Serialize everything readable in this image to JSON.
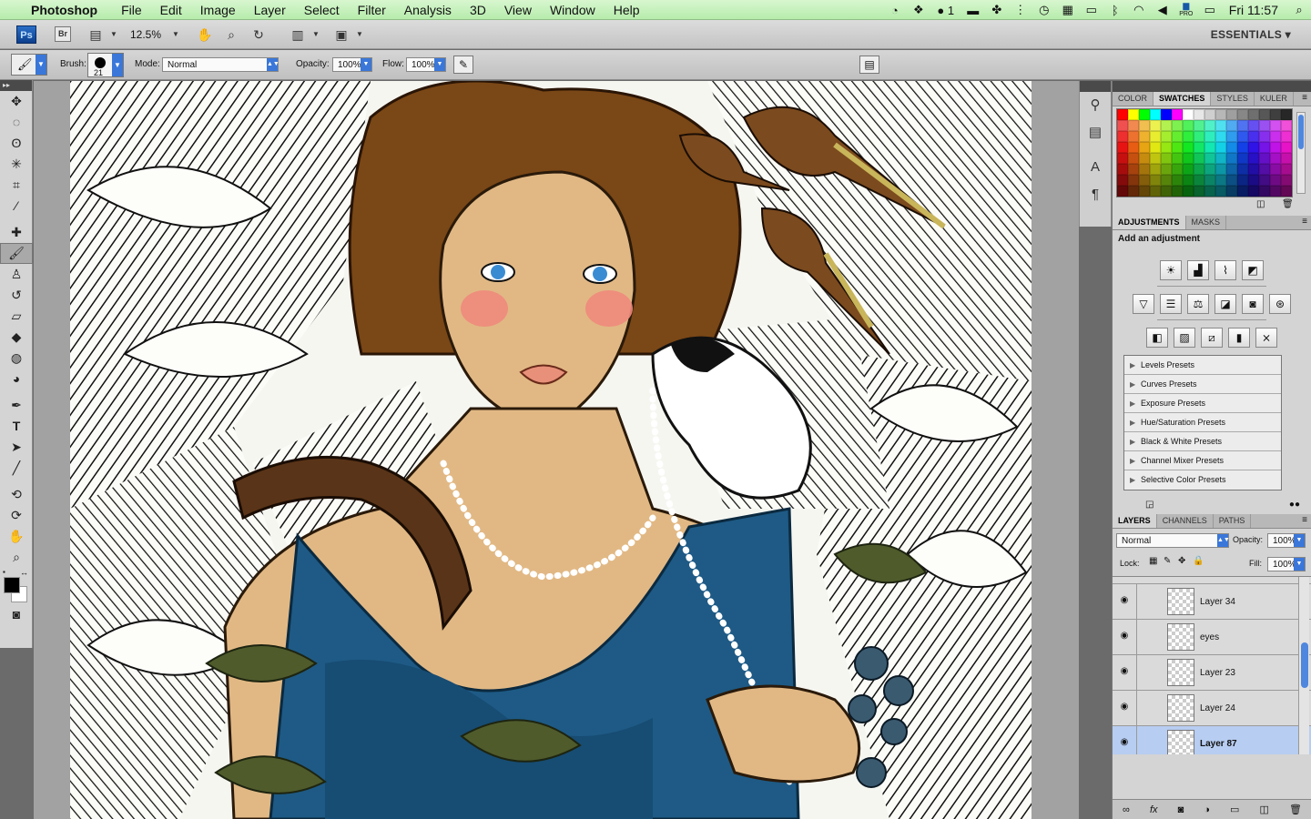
{
  "menubar": {
    "app_name": "Photoshop",
    "items": [
      "File",
      "Edit",
      "Image",
      "Layer",
      "Select",
      "Filter",
      "Analysis",
      "3D",
      "View",
      "Window",
      "Help"
    ],
    "badge_count": "1",
    "keyboard_label": "PRO",
    "clock": "Fri 11:57"
  },
  "appbar": {
    "ps_logo": "Ps",
    "bridge_logo": "Br",
    "zoom": "12.5%",
    "workspace": "ESSENTIALS ▾"
  },
  "options": {
    "brush_label": "Brush:",
    "brush_size": "21",
    "mode_label": "Mode:",
    "mode_value": "Normal",
    "opacity_label": "Opacity:",
    "opacity_value": "100%",
    "flow_label": "Flow:",
    "flow_value": "100%"
  },
  "swatches_panel": {
    "tabs": [
      "COLOR",
      "SWATCHES",
      "STYLES",
      "KULER"
    ],
    "active_tab": "SWATCHES"
  },
  "adjustments_panel": {
    "tabs": [
      "ADJUSTMENTS",
      "MASKS"
    ],
    "title": "Add an adjustment",
    "presets": [
      "Levels Presets",
      "Curves Presets",
      "Exposure Presets",
      "Hue/Saturation Presets",
      "Black & White Presets",
      "Channel Mixer Presets",
      "Selective Color Presets"
    ]
  },
  "layers_panel": {
    "tabs": [
      "LAYERS",
      "CHANNELS",
      "PATHS"
    ],
    "blend_mode": "Normal",
    "opacity_label": "Opacity:",
    "opacity_value": "100%",
    "lock_label": "Lock:",
    "fill_label": "Fill:",
    "fill_value": "100%",
    "layers": [
      {
        "name": "Layer 34",
        "selected": false
      },
      {
        "name": "eyes",
        "selected": false
      },
      {
        "name": "Layer 23",
        "selected": false
      },
      {
        "name": "Layer 24",
        "selected": false
      },
      {
        "name": "Layer 87",
        "selected": true
      }
    ]
  },
  "colors": {
    "accent": "#3a77d9",
    "selection": "#b7cdf1",
    "foreground": "#000000",
    "background": "#ffffff"
  }
}
